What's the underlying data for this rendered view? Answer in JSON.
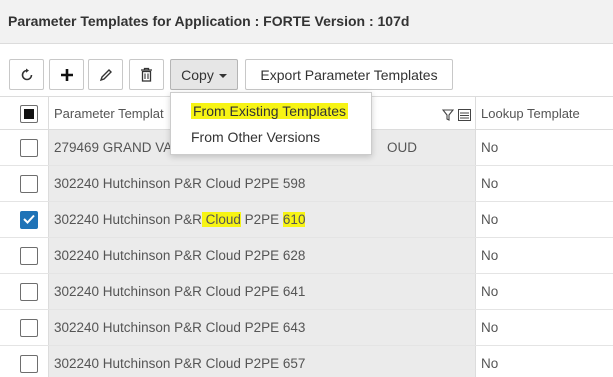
{
  "header": {
    "title": "Parameter Templates for Application : FORTE Version : 107d"
  },
  "toolbar": {
    "buttons": [
      {
        "name": "refresh",
        "icon": "refresh-icon"
      },
      {
        "name": "add",
        "icon": "plus-icon"
      },
      {
        "name": "edit",
        "icon": "pencil-icon"
      },
      {
        "name": "delete",
        "icon": "trash-icon"
      }
    ],
    "copy_label": "Copy",
    "export_label": "Export Parameter Templates"
  },
  "copy_menu": {
    "items": [
      {
        "label": "From Existing Templates",
        "highlighted": true
      },
      {
        "label": "From Other Versions",
        "highlighted": false
      }
    ]
  },
  "grid": {
    "columns": [
      {
        "label": "Parameter Templat",
        "filter_icon": "filter-icon",
        "menu_icon": "column-menu-icon"
      },
      {
        "label": "Lookup Template"
      }
    ],
    "rows": [
      {
        "name": "279469 GRAND VA",
        "name_tail": "OUD",
        "lookup": "No",
        "checked": false
      },
      {
        "name_prefix": "302240 Hutchinson P&R Cloud P2PE ",
        "name_suffix": "598",
        "lookup": "No",
        "checked": false
      },
      {
        "name_prefix": "302240 Hutchinson P&R",
        "name_mid": " Cloud",
        "name_mid2": " P2PE ",
        "name_suffix": "610",
        "lookup": "No",
        "checked": true
      },
      {
        "name_prefix": "302240 Hutchinson P&R Cloud P2PE ",
        "name_suffix": "628",
        "lookup": "No",
        "checked": false
      },
      {
        "name_prefix": "302240 Hutchinson P&R Cloud P2PE ",
        "name_suffix": "641",
        "lookup": "No",
        "checked": false
      },
      {
        "name_prefix": "302240 Hutchinson P&R Cloud P2PE ",
        "name_suffix": "643",
        "lookup": "No",
        "checked": false
      },
      {
        "name_prefix": "302240 Hutchinson P&R Cloud P2PE ",
        "name_suffix": "657",
        "lookup": "No",
        "checked": false
      }
    ]
  },
  "colors": {
    "highlight": "#f7f414",
    "checkbox_checked": "#1f73b7",
    "row_shade": "#ebebeb"
  }
}
